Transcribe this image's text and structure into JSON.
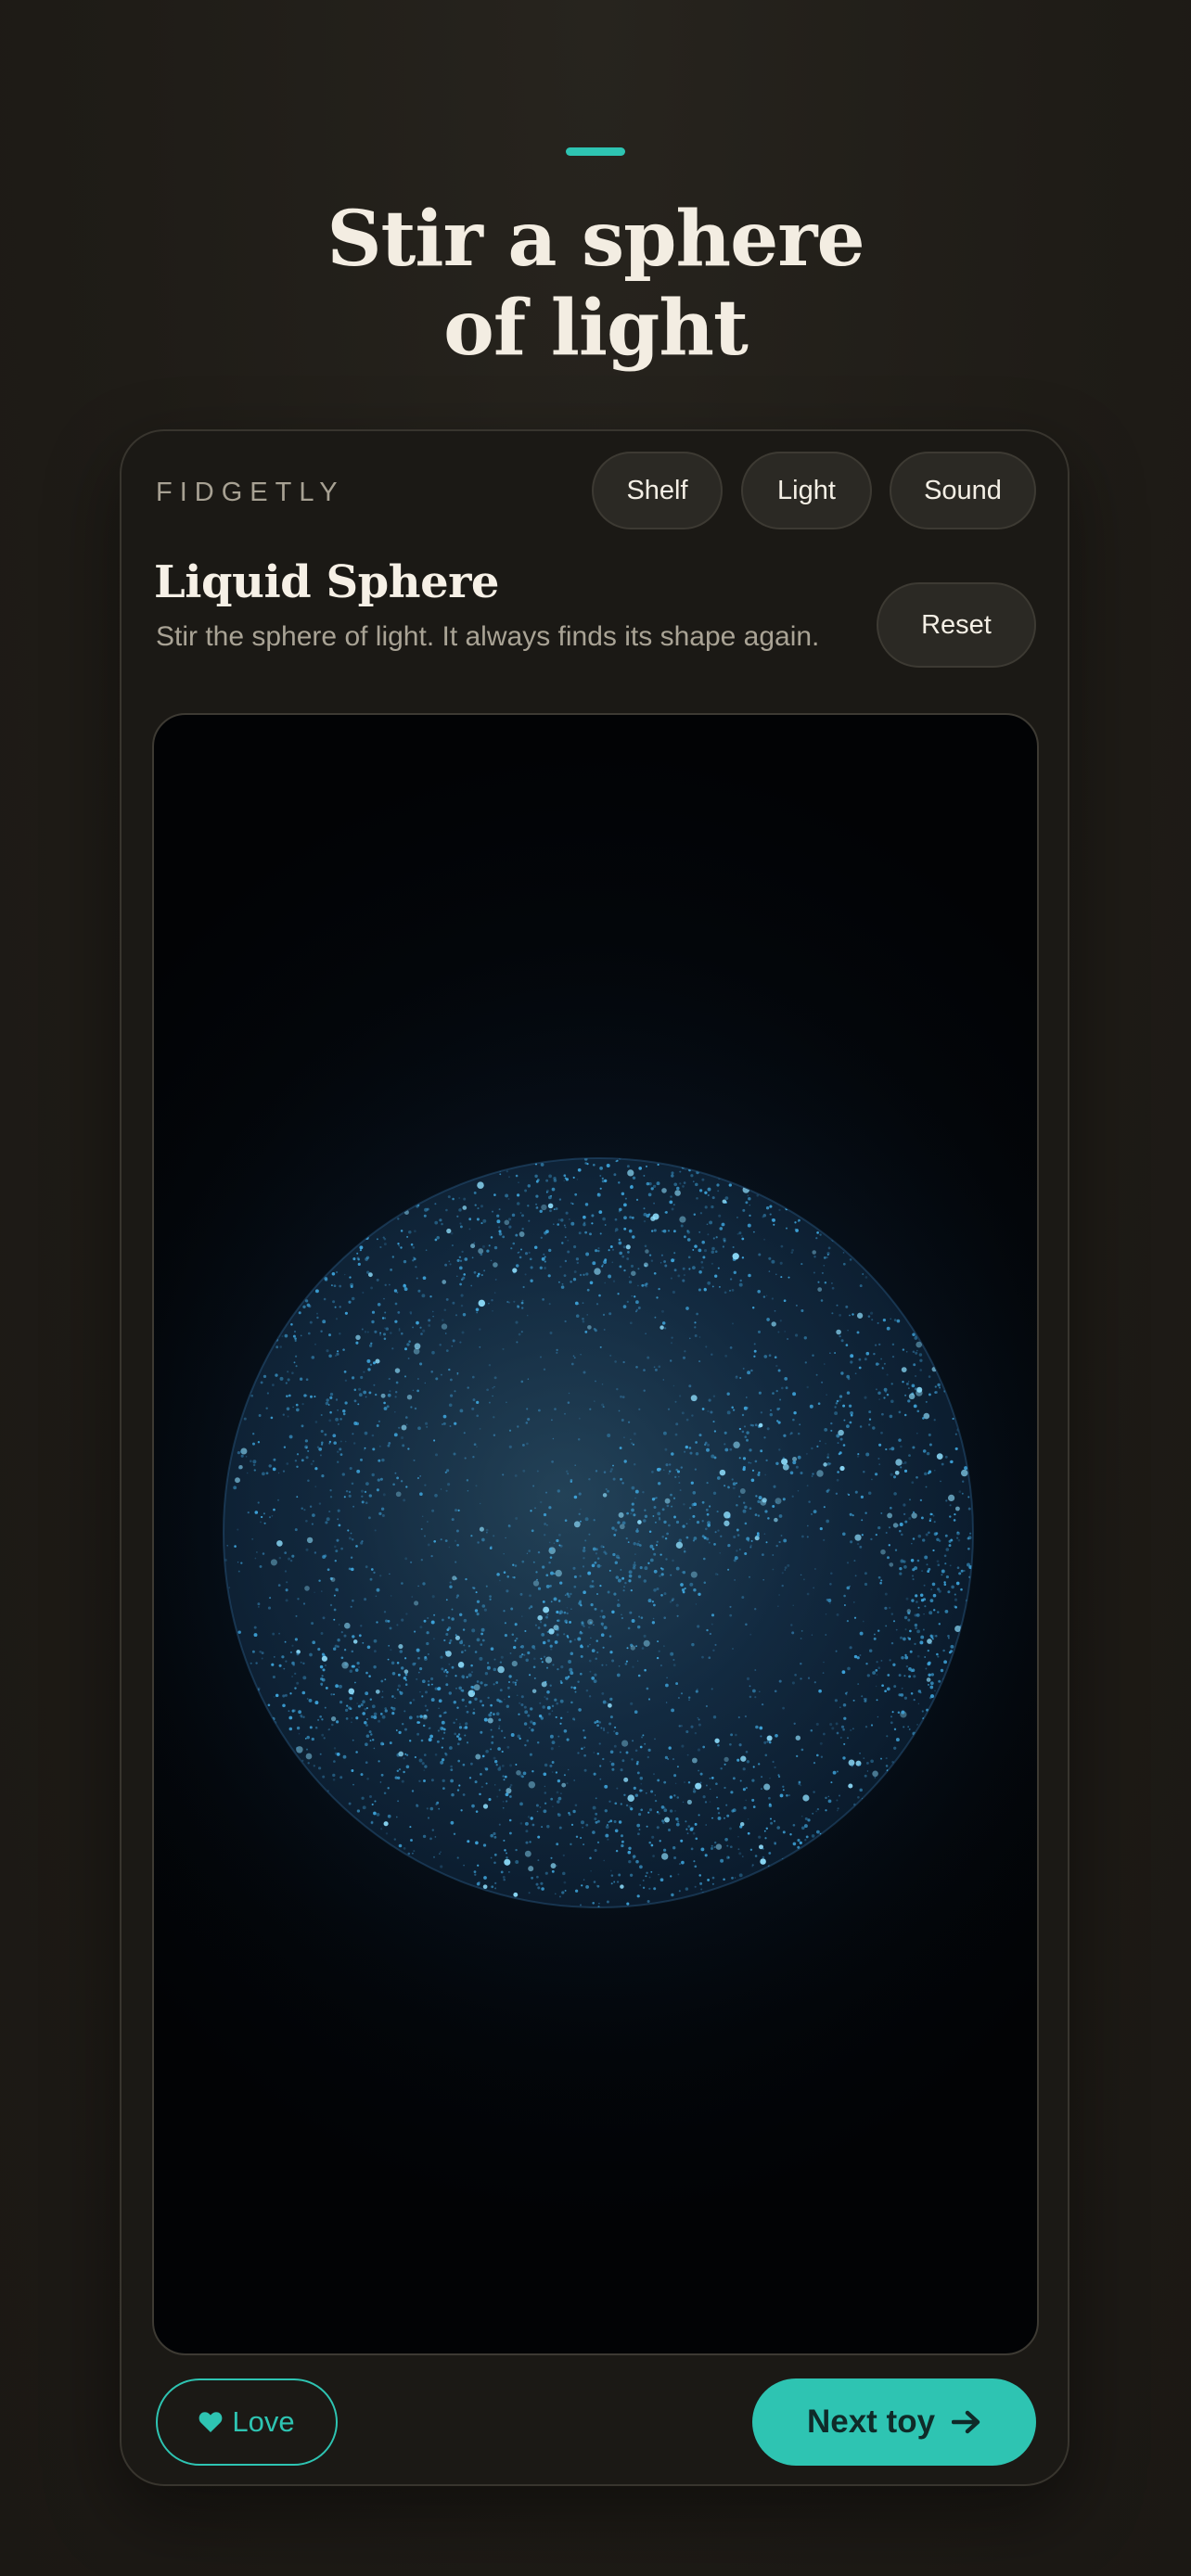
{
  "hero": {
    "title_line1": "Stir a sphere",
    "title_line2": "of light"
  },
  "card": {
    "brand": "FIDGETLY",
    "nav": {
      "shelf": "Shelf",
      "light": "Light",
      "sound": "Sound"
    },
    "toy": {
      "title": "Liquid Sphere",
      "description": "Stir the sphere of light. It always finds its shape again."
    },
    "reset_label": "Reset",
    "footer": {
      "love_label": "Love",
      "love_icon": "heart-icon",
      "next_label": "Next toy",
      "next_icon": "arrow-right-icon"
    }
  },
  "colors": {
    "accent": "#2ec4b2",
    "background": "#221f1a",
    "card": "#1b1915",
    "particle": "#4fb8ee"
  }
}
